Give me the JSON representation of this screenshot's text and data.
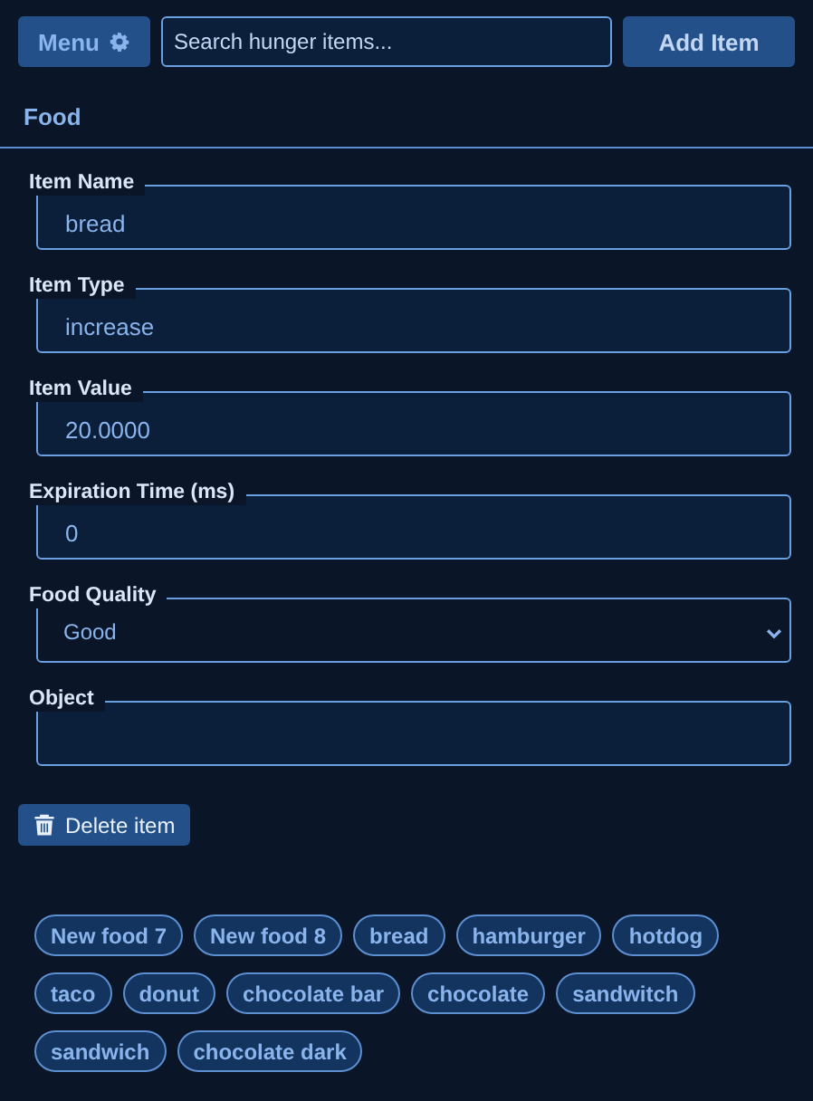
{
  "toolbar": {
    "menu_button": "Menu",
    "search": {
      "placeholder": "Search hunger items..."
    },
    "add_button": "Add Item"
  },
  "section_title": "Food",
  "fields": [
    {
      "kind": "text",
      "label": "Item Name",
      "value": "bread"
    },
    {
      "kind": "text",
      "label": "Item Type",
      "value": "increase"
    },
    {
      "kind": "text",
      "label": "Item Value",
      "value": "20.0000"
    },
    {
      "kind": "text",
      "label": "Expiration Time (ms)",
      "value": "0"
    },
    {
      "kind": "select",
      "label": "Food Quality",
      "value": "Good"
    },
    {
      "kind": "text",
      "label": "Object"
    }
  ],
  "delete_button": "Delete item",
  "items": [
    "New food 7",
    "New food 8",
    "bread",
    "hamburger",
    "hotdog",
    "taco",
    "donut",
    "chocolate bar",
    "chocolate",
    "sandwitch",
    "sandwich",
    "chocolate dark"
  ]
}
